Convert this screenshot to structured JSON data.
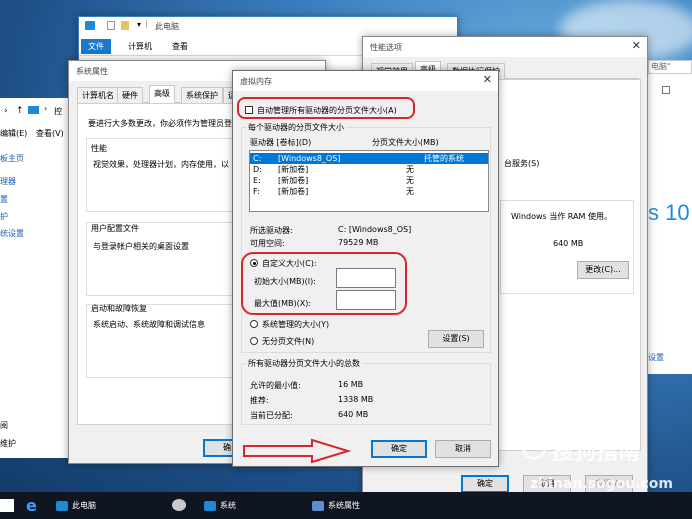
{
  "colors": {
    "accent": "#0078d7",
    "annotation_red": "#d9262b",
    "taskbar": "#101621"
  },
  "explorer": {
    "title": "此电脑",
    "ribbon_tabs": [
      "文件",
      "计算机",
      "查看"
    ],
    "right_search_fragment": "电脑\"",
    "left_nav": [
      "控",
      "编辑(E)",
      "查看(V)",
      "板主页",
      "理器",
      "置",
      "护",
      "统设置",
      "阅",
      "维护"
    ]
  },
  "sysprops": {
    "title": "系统属性",
    "tabs": [
      "计算机名",
      "硬件",
      "高级",
      "系统保护",
      "远"
    ],
    "intro": "要进行大多数更改，你必须作为管理员登",
    "groups": [
      {
        "title": "性能",
        "text": "视觉效果，处理器计划，内存使用，以"
      },
      {
        "title": "用户配置文件",
        "text": "与登录帐户相关的桌面设置"
      },
      {
        "title": "启动和故障恢复",
        "text": "系统启动、系统故障和调试信息"
      }
    ],
    "ok_fragment": "确"
  },
  "perfopts": {
    "title": "性能选项",
    "tabs": [
      "视觉效果",
      "高级",
      "数据执行保护"
    ],
    "service_text": "台服务(S)",
    "ram_text": "Windows 当作 RAM 使用。",
    "size": "640 MB",
    "change_button": "更改(C)...",
    "ok": "确定",
    "cancel": "取消",
    "apply": "应用(A)",
    "brand_fragment": "s 10",
    "settings_link": "设置"
  },
  "vmem": {
    "title": "虚拟内存",
    "auto_manage_label": "自动管理所有驱动器的分页文件大小(A)",
    "group_title": "每个驱动器的分页文件大小",
    "col_drive": "驱动器 [卷标](D)",
    "col_size": "分页文件大小(MB)",
    "drives": [
      {
        "drive": "C:",
        "label": "[Windows8_OS]",
        "size": "托管的系统"
      },
      {
        "drive": "D:",
        "label": "[新加卷]",
        "size": "无"
      },
      {
        "drive": "E:",
        "label": "[新加卷]",
        "size": "无"
      },
      {
        "drive": "F:",
        "label": "[新加卷]",
        "size": "无"
      }
    ],
    "selected_drive_label": "所选驱动器:",
    "selected_drive_value": "C:  [Windows8_OS]",
    "free_space_label": "可用空间:",
    "free_space_value": "79529 MB",
    "custom_size_label": "自定义大小(C):",
    "initial_size_label": "初始大小(MB)(I):",
    "initial_size_value": "",
    "max_size_label": "最大值(MB)(X):",
    "max_size_value": "",
    "system_managed_label": "系统管理的大小(Y)",
    "no_paging_label": "无分页文件(N)",
    "set_button": "设置(S)",
    "totals_title": "所有驱动器分页文件大小的总数",
    "min_allowed_label": "允许的最小值:",
    "min_allowed_value": "16 MB",
    "recommended_label": "推荐:",
    "recommended_value": "1338 MB",
    "allocated_label": "当前已分配:",
    "allocated_value": "640 MB",
    "ok": "确定",
    "cancel": "取消"
  },
  "taskbar": {
    "items": [
      "此电脑",
      "系统",
      "系统属性"
    ],
    "edge_icon": "e"
  },
  "watermark": {
    "text": "搜狗指南",
    "url": "zhinan.sogou.com"
  }
}
